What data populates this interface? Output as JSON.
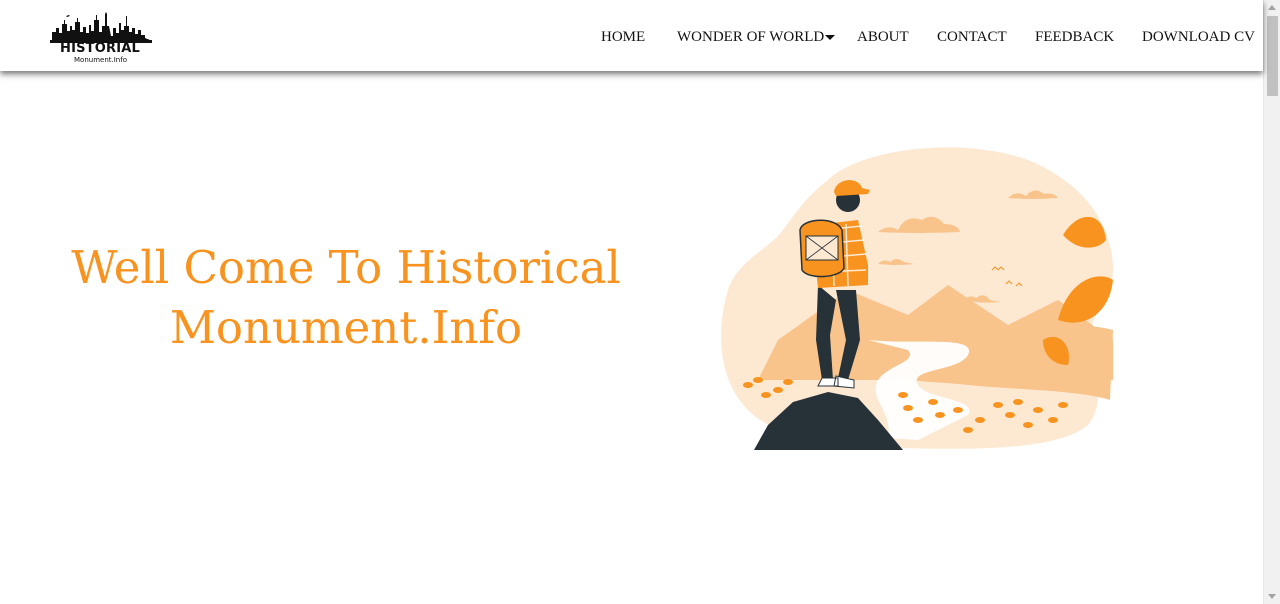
{
  "brand": {
    "title": "HISTORIAL",
    "subtitle": "Monument.Info",
    "logo_icon": "city-skyline-icon"
  },
  "nav": {
    "items": [
      {
        "label": "HOME"
      },
      {
        "label": "WONDER OF WORLD",
        "has_dropdown": true
      },
      {
        "label": "ABOUT"
      },
      {
        "label": "CONTACT"
      },
      {
        "label": "FEEDBACK"
      },
      {
        "label": "DOWNLOAD CV"
      }
    ]
  },
  "hero": {
    "line1": "Well Come To Historical",
    "line2": "Monument.Info",
    "illustration": "hiker-on-rock-illustration"
  },
  "colors": {
    "accent": "#f7931e",
    "accent_light": "#fde8d2",
    "accent_mid": "#f9c48c",
    "dark": "#263238"
  }
}
